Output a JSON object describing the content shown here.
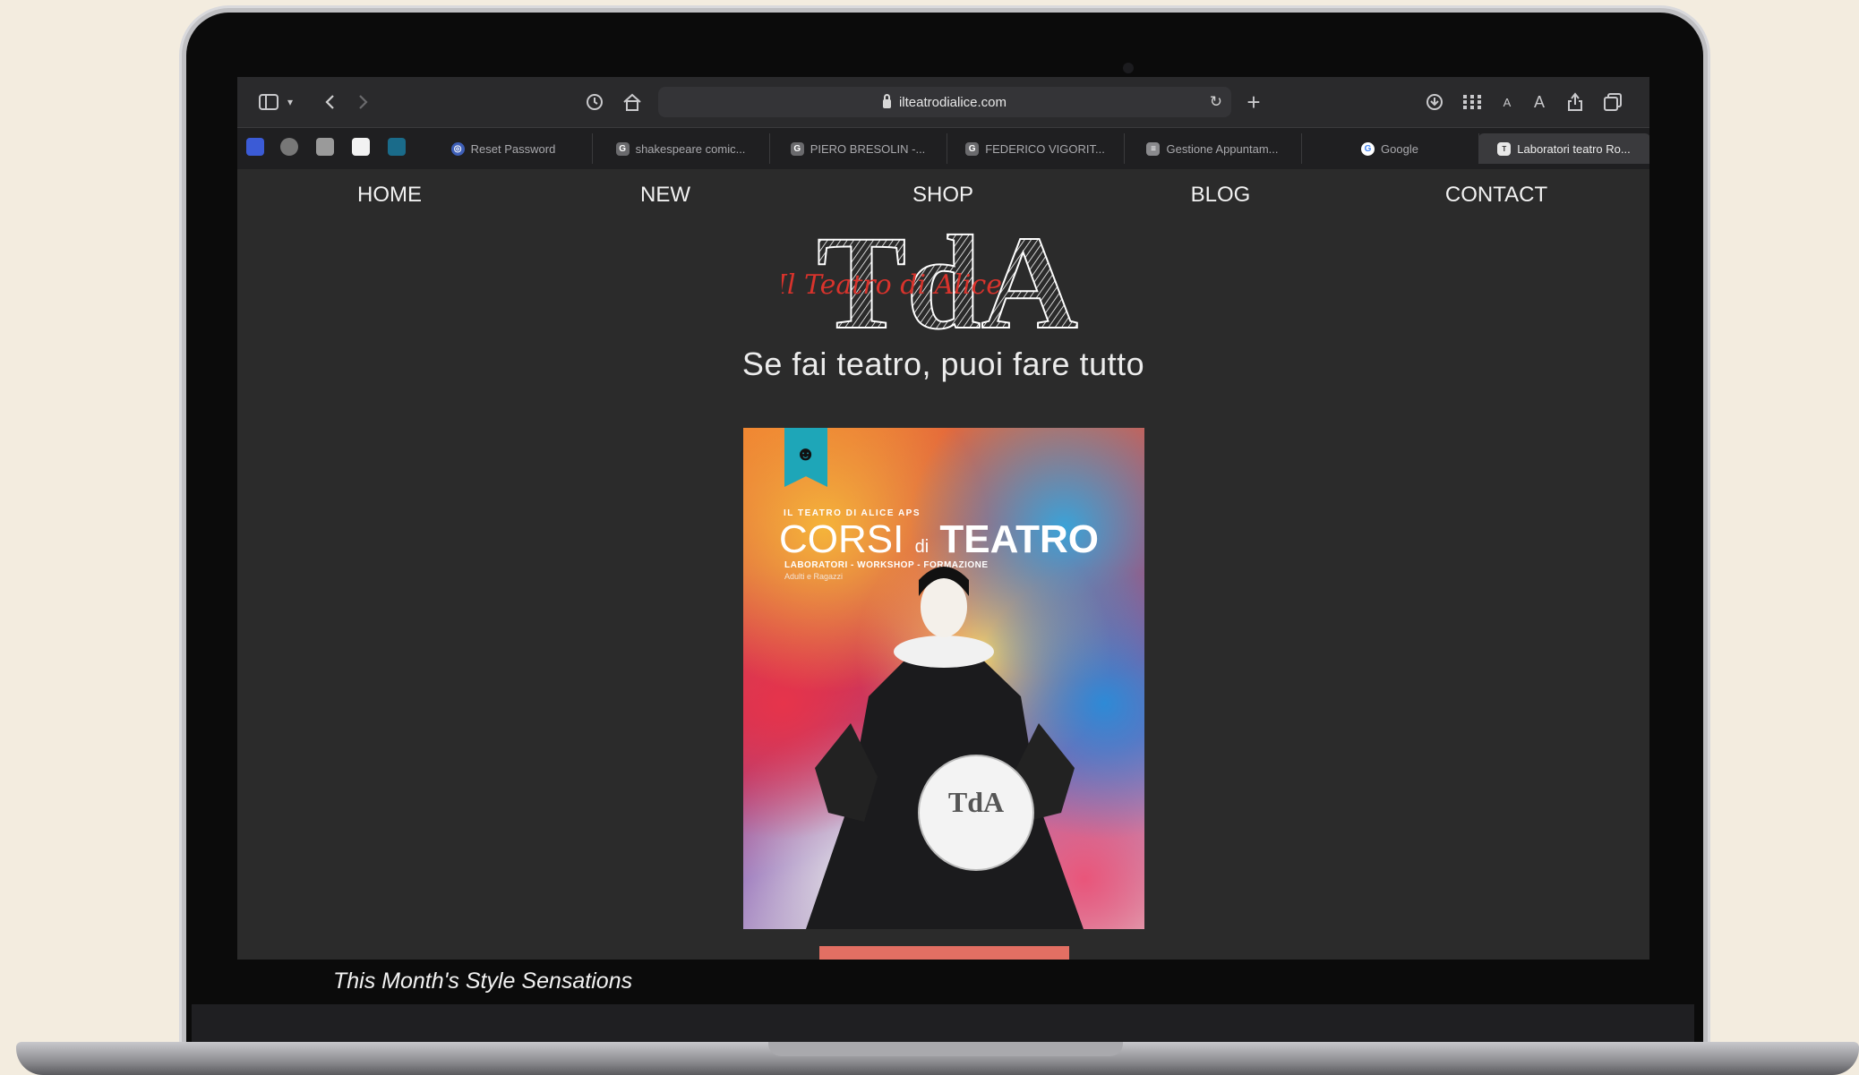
{
  "browser": {
    "url": "ilteatrodialice.com",
    "tabs": [
      {
        "label": "Reset Password",
        "icon": "globe-icon"
      },
      {
        "label": "shakespeare comic...",
        "icon": "g-icon"
      },
      {
        "label": "PIERO BRESOLIN -...",
        "icon": "g-icon"
      },
      {
        "label": "FEDERICO VIGORIT...",
        "icon": "g-icon"
      },
      {
        "label": "Gestione Appuntam...",
        "icon": "doc-icon"
      },
      {
        "label": "Google",
        "icon": "google-icon"
      },
      {
        "label": "Laboratori teatro Ro...",
        "icon": "tda-icon"
      }
    ],
    "pinned_favicons": [
      "calendar-icon",
      "settings-icon",
      "notion-icon",
      "cloud-icon",
      "boat-icon"
    ],
    "reader_small": "A",
    "reader_large": "A"
  },
  "site": {
    "nav": [
      "HOME",
      "NEW",
      "SHOP",
      "BLOG",
      "CONTACT"
    ],
    "logo_letters": "TdA",
    "logo_script": "Il Teatro di Alice",
    "tagline": "Se fai teatro, puoi fare tutto",
    "poster": {
      "kicker": "IL TEATRO DI ALICE APS",
      "title_thin": "CORSI",
      "title_di": "di",
      "title_bold": "TEATRO",
      "subtitle": "LABORATORI - WORKSHOP - FORMAZIONE",
      "subtitle2": "Adulti e Ragazzi"
    },
    "caption": "This Month's Style Sensations"
  },
  "colors": {
    "page_bg": "#2b2b2b",
    "accent": "#e36f63",
    "logo_red": "#d8332c"
  }
}
